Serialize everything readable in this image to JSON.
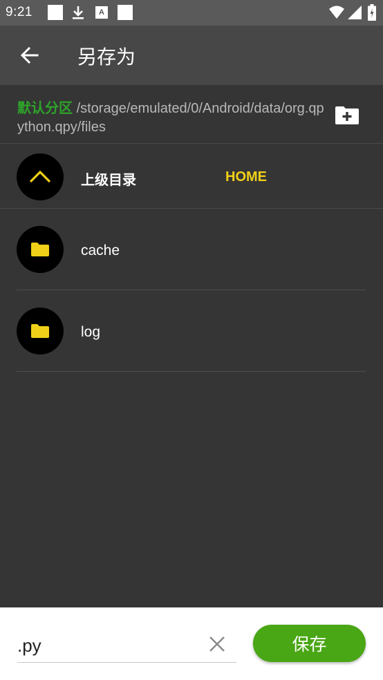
{
  "status_bar": {
    "time": "9:21",
    "icons": [
      "square-icon",
      "download-icon",
      "a-icon",
      "square-icon",
      "wifi-icon",
      "cell-signal-icon",
      "battery-icon"
    ]
  },
  "app_bar": {
    "back_icon": "arrow-left-icon",
    "title": "另存为"
  },
  "path": {
    "label": "默认分区",
    "value": "/storage/emulated/0/Android/data/org.qpython.qpy/files",
    "new_folder_icon": "new-folder-icon",
    "label_color": "#2ea32a"
  },
  "parent": {
    "icon": "chevron-up-icon",
    "label": "上级目录",
    "home": "HOME",
    "accent_color": "#f0d018"
  },
  "folders": [
    {
      "name": "cache",
      "icon": "folder-icon"
    },
    {
      "name": "log",
      "icon": "folder-icon"
    }
  ],
  "bottom": {
    "filename_value": ".py",
    "clear_icon": "close-icon",
    "save_label": "保存",
    "save_color": "#49a614"
  }
}
